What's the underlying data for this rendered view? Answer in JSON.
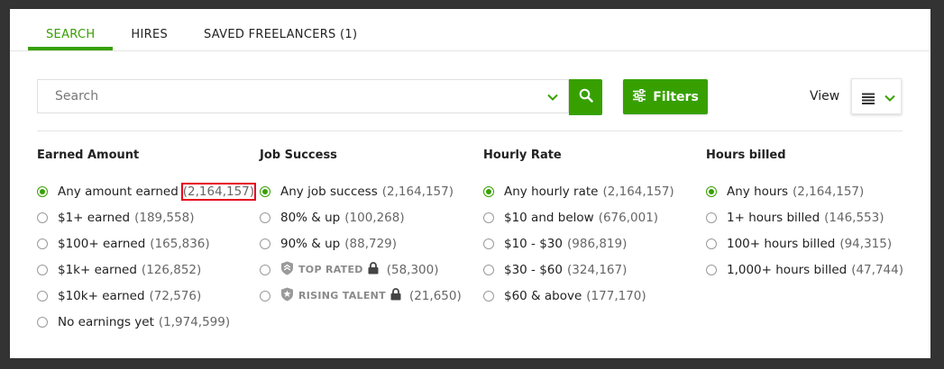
{
  "tabs": [
    {
      "label": "SEARCH",
      "active": true
    },
    {
      "label": "HIRES",
      "active": false
    },
    {
      "label": "SAVED FREELANCERS (1)",
      "active": false
    }
  ],
  "search": {
    "placeholder": "Search",
    "value": ""
  },
  "filters_button": {
    "label": "Filters"
  },
  "view": {
    "label": "View",
    "icon": "list-icon"
  },
  "colors": {
    "accent": "#37a000",
    "highlight": "#e8001c"
  },
  "columns": {
    "earned": {
      "title": "Earned Amount",
      "options": [
        {
          "label": "Any amount earned",
          "count": "(2,164,157)",
          "checked": true
        },
        {
          "label": "$1+ earned",
          "count": "(189,558)"
        },
        {
          "label": "$100+ earned",
          "count": "(165,836)"
        },
        {
          "label": "$1k+ earned",
          "count": "(126,852)"
        },
        {
          "label": "$10k+ earned",
          "count": "(72,576)"
        },
        {
          "label": "No earnings yet",
          "count": "(1,974,599)"
        }
      ]
    },
    "job_success": {
      "title": "Job Success",
      "options": [
        {
          "label": "Any job success",
          "count": "(2,164,157)",
          "checked": true
        },
        {
          "label": "80% & up",
          "count": "(100,268)"
        },
        {
          "label": "90% & up",
          "count": "(88,729)"
        },
        {
          "label": "TOP RATED",
          "count": "(58,300)"
        },
        {
          "label": "RISING TALENT",
          "count": "(21,650)"
        }
      ]
    },
    "hourly_rate": {
      "title": "Hourly Rate",
      "options": [
        {
          "label": "Any hourly rate",
          "count": "(2,164,157)",
          "checked": true
        },
        {
          "label": "$10 and below",
          "count": "(676,001)"
        },
        {
          "label": "$10 - $30",
          "count": "(986,819)"
        },
        {
          "label": "$30 - $60",
          "count": "(324,167)"
        },
        {
          "label": "$60 & above",
          "count": "(177,170)"
        }
      ]
    },
    "hours_billed": {
      "title": "Hours billed",
      "options": [
        {
          "label": "Any hours",
          "count": "(2,164,157)",
          "checked": true
        },
        {
          "label": "1+ hours billed",
          "count": "(146,553)"
        },
        {
          "label": "100+ hours billed",
          "count": "(94,315)"
        },
        {
          "label": "1,000+ hours billed",
          "count": "(47,744)"
        }
      ]
    }
  }
}
